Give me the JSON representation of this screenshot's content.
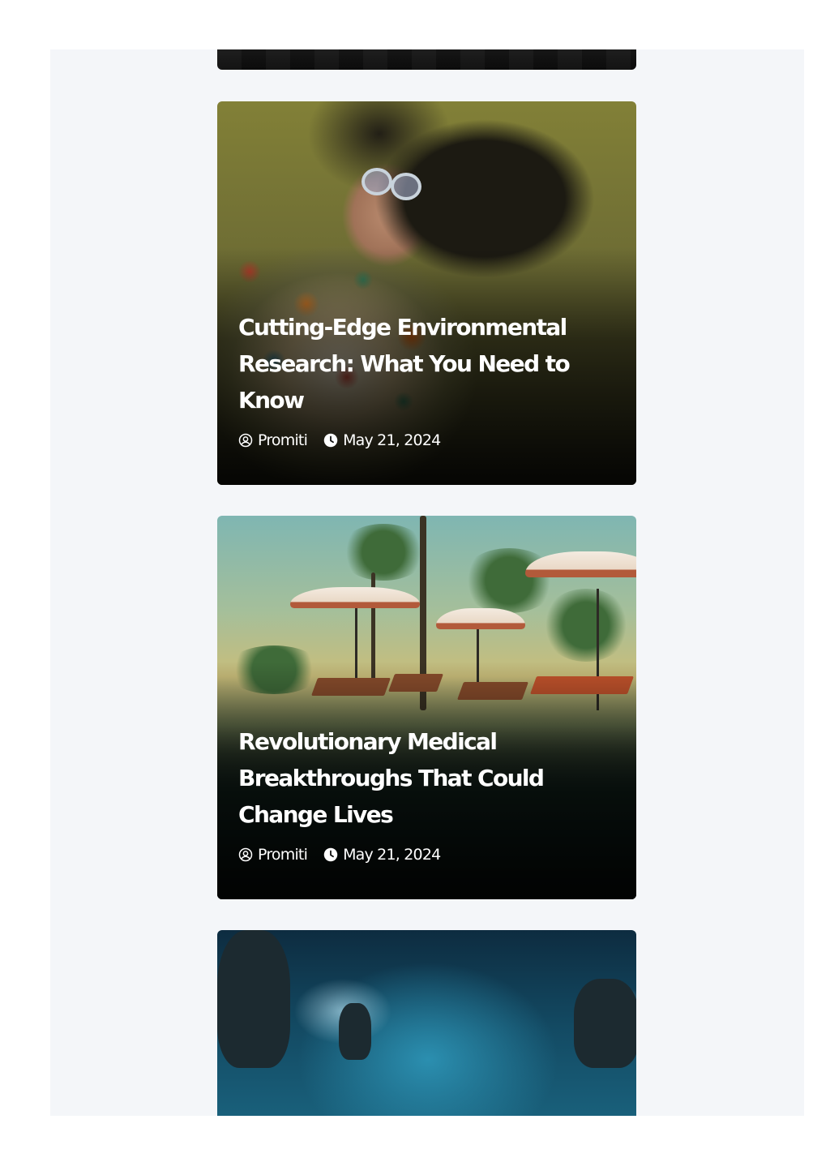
{
  "posts": [
    {
      "title": "Cutting-Edge Environmental Research: What You Need to Know",
      "author": "Promiti",
      "date": "May 21, 2024"
    },
    {
      "title": "Revolutionary Medical Breakthroughs That Could Change Lives",
      "author": "Promiti",
      "date": "May 21, 2024"
    }
  ],
  "icons": {
    "author": "user-circle-icon",
    "date": "clock-icon"
  },
  "colors": {
    "page_background": "#f4f6f9",
    "text_on_card": "#ffffff"
  }
}
